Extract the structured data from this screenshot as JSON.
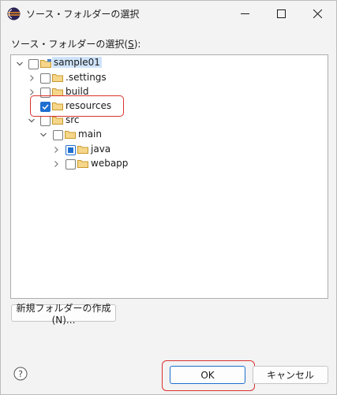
{
  "window": {
    "title": "ソース・フォルダーの選択",
    "icon": "eclipse-icon",
    "controls": [
      "minimize-icon",
      "maximize-icon",
      "close-icon"
    ]
  },
  "prompt": {
    "text_before": "ソース・フォルダーの選択(",
    "mnemonic": "S",
    "text_after": "):"
  },
  "tree": {
    "nodes": [
      {
        "label": "sample01",
        "expanded": true,
        "checked": "unchecked",
        "selected": true
      },
      {
        "label": ".settings",
        "expanded": false,
        "checked": "unchecked"
      },
      {
        "label": "build",
        "expanded": false,
        "checked": "unchecked"
      },
      {
        "label": "resources",
        "expanded": false,
        "checked": "checked",
        "highlighted": true
      },
      {
        "label": "src",
        "expanded": true,
        "checked": "unchecked"
      },
      {
        "label": "main",
        "expanded": true,
        "checked": "unchecked"
      },
      {
        "label": "java",
        "expanded": false,
        "checked": "partial"
      },
      {
        "label": "webapp",
        "expanded": false,
        "checked": "unchecked"
      }
    ]
  },
  "buttons": {
    "new_folder": "新規フォルダーの作成(N)...",
    "ok": "OK",
    "cancel": "キャンセル"
  },
  "colors": {
    "accent": "#1e6fd0",
    "highlight_outline": "#d9322e",
    "selection": "#cfe4fb",
    "folder": "#e8b54a"
  }
}
